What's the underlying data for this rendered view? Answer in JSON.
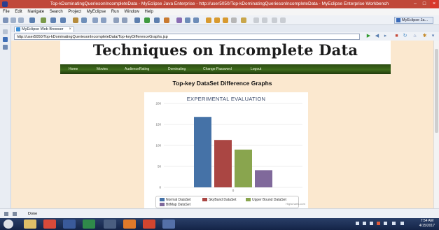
{
  "window": {
    "title": "Top-kDominatingQueriesonIncompleteData - MyEclipse Java Enterprise - http://user5050/Top-kDominatingQueriesonIncompleteData - MyEclipse Enterprise Workbench"
  },
  "menu": [
    "File",
    "Edit",
    "Navigate",
    "Search",
    "Project",
    "MyEclipse",
    "Run",
    "Window",
    "Help"
  ],
  "perspective": {
    "label": "MyEclipse Ja..."
  },
  "browser": {
    "tab_label": "MyEclipse Web Browser",
    "url": "http://user5050/Top-kDominatingQueriesonIncompleteData/Top-keyDifferenceGraphs.jsp"
  },
  "page": {
    "banner_title": "Techniques on Incomplete Data",
    "nav": [
      "Home",
      "Movies",
      "AudienceRating",
      "Dominating",
      "Change Password",
      "Logout"
    ],
    "heading": "Top-key DataSet Difference Graphs",
    "credit": "Highcharts.com"
  },
  "status": {
    "text": "Done"
  },
  "clock": {
    "time": "7:54 AM",
    "date": "4/15/2017"
  },
  "chart_data": {
    "type": "bar",
    "title": "EXPERIMENTAL EVALUATION",
    "categories": [
      "0"
    ],
    "ylim": [
      0,
      200
    ],
    "yticks": [
      0,
      50,
      100,
      150,
      200
    ],
    "grid": true,
    "legend_position": "bottom",
    "series": [
      {
        "name": "Normal DataSet",
        "color": "#4572A7",
        "values": [
          168
        ]
      },
      {
        "name": "SkyBand DataSet",
        "color": "#AA4643",
        "values": [
          113
        ]
      },
      {
        "name": "Upper Bound DataSet",
        "color": "#89A54E",
        "values": [
          90
        ]
      },
      {
        "name": "BitMap DataSet",
        "color": "#80699B",
        "values": [
          41
        ]
      }
    ]
  }
}
